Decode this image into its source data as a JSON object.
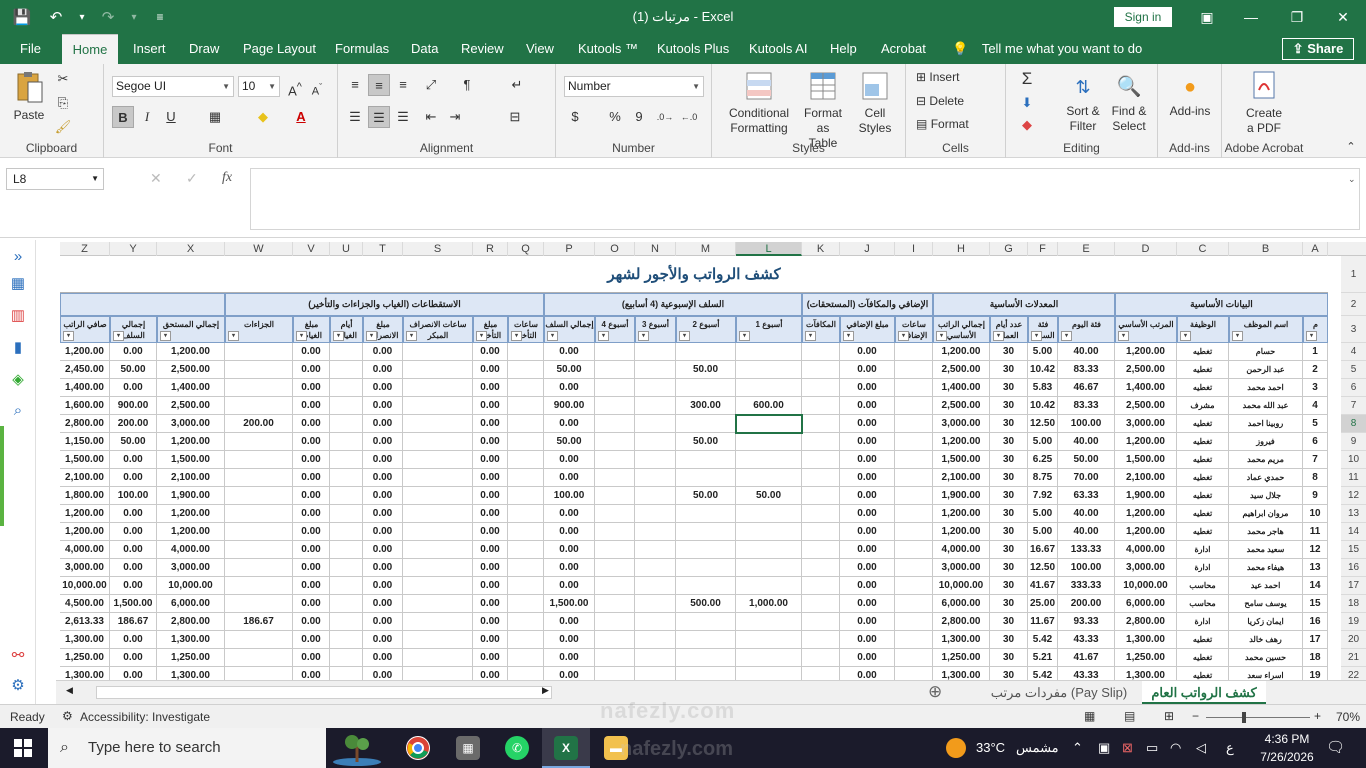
{
  "window": {
    "title": "مرتبات (1)  -  Excel",
    "sign_in": "Sign in",
    "minimize": "—",
    "restore": "❐",
    "close": "✕",
    "ribbon_display": "▣"
  },
  "qat": {
    "save": "💾",
    "undo": "↶",
    "undo_dd": "▾",
    "redo": "↷",
    "redo_dd": "▾",
    "customize": "≡"
  },
  "tabs": [
    "File",
    "Home",
    "Insert",
    "Draw",
    "Page Layout",
    "Formulas",
    "Data",
    "Review",
    "View",
    "Kutools ™",
    "Kutools Plus",
    "Kutools AI",
    "Help",
    "Acrobat"
  ],
  "tell_me": "Tell me what you want to do",
  "share": "Share",
  "ribbon": {
    "clipboard": {
      "label": "Clipboard",
      "paste": "Paste"
    },
    "font": {
      "label": "Font",
      "font_name": "Segoe UI",
      "font_size": "10",
      "bold": "B",
      "italic": "I",
      "underline": "U"
    },
    "alignment": {
      "label": "Alignment"
    },
    "number": {
      "label": "Number",
      "format": "Number",
      "currency": "$",
      "percent": "%",
      "comma": "9"
    },
    "styles": {
      "label": "Styles",
      "conditional_line1": "Conditional",
      "conditional_line2": "Formatting",
      "table_line1": "Format as",
      "table_line2": "Table",
      "cell_line1": "Cell",
      "cell_line2": "Styles"
    },
    "cells": {
      "label": "Cells",
      "insert": "Insert",
      "delete": "Delete",
      "format": "Format"
    },
    "editing": {
      "label": "Editing",
      "sort_line1": "Sort &",
      "sort_line2": "Filter",
      "find_line1": "Find &",
      "find_line2": "Select"
    },
    "addins": {
      "label": "Add-ins",
      "button": "Add-ins"
    },
    "acrobat": {
      "label": "Adobe Acrobat",
      "line1": "Create",
      "line2": "a PDF"
    }
  },
  "formula_bar": {
    "name_box": "L8",
    "fx": "fx",
    "cancel": "✕",
    "enter": "✓",
    "formula": ""
  },
  "columns": [
    "Z",
    "Y",
    "X",
    "W",
    "V",
    "U",
    "T",
    "S",
    "R",
    "Q",
    "P",
    "O",
    "N",
    "M",
    "L",
    "K",
    "J",
    "I",
    "H",
    "G",
    "F",
    "E",
    "D",
    "C",
    "B",
    "A"
  ],
  "selected_column": "L",
  "row_headers": [
    "1",
    "2",
    "3",
    "4",
    "5",
    "6",
    "7",
    "8",
    "9",
    "10",
    "11",
    "12",
    "13",
    "14",
    "15",
    "16",
    "17",
    "18",
    "19",
    "20",
    "21",
    "22"
  ],
  "selected_row": "8",
  "sheet": {
    "title": "كشف الرواتب والأجور لشهر",
    "bands": {
      "basic": "البيانات الأساسية",
      "rates": "المعدلات الأساسية",
      "bonuses": "الإضافي والمكافآت (المستحقات)",
      "advances": "السلف الإسبوعية (4 أسابيع)",
      "deductions": "الاستقطاعات (الغياب والجزاءات والتأخير)"
    },
    "headers": {
      "net": "صافي الراتب",
      "total_advances": "إجمالي السلف",
      "total_due": "إجمالي المستحق",
      "penalties": "الجزاءات",
      "absence_amount": "مبلغ الغياب",
      "absence_days": "أيام الغياب",
      "early_amount": "مبلغ الانصراف",
      "early_hours": "ساعات الانصراف المبكر",
      "late_amount": "مبلغ التأخير",
      "late_hours": "ساعات التأخير",
      "advances_total": "إجمالي السلف",
      "week4": "أسبوع 4",
      "week3": "أسبوع 3",
      "week2": "أسبوع 2",
      "week1": "أسبوع 1",
      "bonus": "المكافآت",
      "overtime_amount": "مبلغ الإضافي",
      "overtime_hours": "ساعات الإضافي",
      "gross": "إجمالي الراتب الأساسي",
      "work_days": "عدد أيام العمل",
      "hour_rate": "فئة الساعة",
      "day_rate": "فئة اليوم",
      "salary": "المرتب الأساسي",
      "job": "الوظيفة",
      "name": "اسم الموظف",
      "num": "م"
    },
    "rows": [
      {
        "n": "1",
        "name": "حسام",
        "job": "تغطيه",
        "salary": "1,200.00",
        "day": "40.00",
        "hour": "5.00",
        "days": "30",
        "gross": "1,200.00",
        "ot": "0.00",
        "w1": "",
        "w2": "",
        "adv": "0.00",
        "late": "0.00",
        "early": "0.00",
        "abs": "0.00",
        "pen": "",
        "due": "1,200.00",
        "tadv": "0.00",
        "net": "1,200.00"
      },
      {
        "n": "2",
        "name": "عبد الرحمن",
        "job": "تغطيه",
        "salary": "2,500.00",
        "day": "83.33",
        "hour": "10.42",
        "days": "30",
        "gross": "2,500.00",
        "ot": "0.00",
        "w1": "",
        "w2": "50.00",
        "adv": "50.00",
        "late": "0.00",
        "early": "0.00",
        "abs": "0.00",
        "pen": "",
        "due": "2,500.00",
        "tadv": "50.00",
        "net": "2,450.00"
      },
      {
        "n": "3",
        "name": "احمد محمد",
        "job": "تغطيه",
        "salary": "1,400.00",
        "day": "46.67",
        "hour": "5.83",
        "days": "30",
        "gross": "1,400.00",
        "ot": "0.00",
        "w1": "",
        "w2": "",
        "adv": "0.00",
        "late": "0.00",
        "early": "0.00",
        "abs": "0.00",
        "pen": "",
        "due": "1,400.00",
        "tadv": "0.00",
        "net": "1,400.00"
      },
      {
        "n": "4",
        "name": "عبد الله محمد",
        "job": "مشرف",
        "salary": "2,500.00",
        "day": "83.33",
        "hour": "10.42",
        "days": "30",
        "gross": "2,500.00",
        "ot": "0.00",
        "w1": "600.00",
        "w2": "300.00",
        "adv": "900.00",
        "late": "0.00",
        "early": "0.00",
        "abs": "0.00",
        "pen": "",
        "due": "2,500.00",
        "tadv": "900.00",
        "net": "1,600.00"
      },
      {
        "n": "5",
        "name": "روبينا احمد",
        "job": "تغطيه",
        "salary": "3,000.00",
        "day": "100.00",
        "hour": "12.50",
        "days": "30",
        "gross": "3,000.00",
        "ot": "0.00",
        "w1": "",
        "w2": "",
        "adv": "0.00",
        "late": "0.00",
        "early": "0.00",
        "abs": "0.00",
        "pen": "200.00",
        "due": "3,000.00",
        "tadv": "200.00",
        "net": "2,800.00"
      },
      {
        "n": "6",
        "name": "فيروز",
        "job": "تغطيه",
        "salary": "1,200.00",
        "day": "40.00",
        "hour": "5.00",
        "days": "30",
        "gross": "1,200.00",
        "ot": "0.00",
        "w1": "",
        "w2": "50.00",
        "adv": "50.00",
        "late": "0.00",
        "early": "0.00",
        "abs": "0.00",
        "pen": "",
        "due": "1,200.00",
        "tadv": "50.00",
        "net": "1,150.00"
      },
      {
        "n": "7",
        "name": "مريم محمد",
        "job": "تغطيه",
        "salary": "1,500.00",
        "day": "50.00",
        "hour": "6.25",
        "days": "30",
        "gross": "1,500.00",
        "ot": "0.00",
        "w1": "",
        "w2": "",
        "adv": "0.00",
        "late": "0.00",
        "early": "0.00",
        "abs": "0.00",
        "pen": "",
        "due": "1,500.00",
        "tadv": "0.00",
        "net": "1,500.00"
      },
      {
        "n": "8",
        "name": "حمدي عماد",
        "job": "تغطيه",
        "salary": "2,100.00",
        "day": "70.00",
        "hour": "8.75",
        "days": "30",
        "gross": "2,100.00",
        "ot": "0.00",
        "w1": "",
        "w2": "",
        "adv": "0.00",
        "late": "0.00",
        "early": "0.00",
        "abs": "0.00",
        "pen": "",
        "due": "2,100.00",
        "tadv": "0.00",
        "net": "2,100.00"
      },
      {
        "n": "9",
        "name": "جلال سيد",
        "job": "تغطيه",
        "salary": "1,900.00",
        "day": "63.33",
        "hour": "7.92",
        "days": "30",
        "gross": "1,900.00",
        "ot": "0.00",
        "w1": "50.00",
        "w2": "50.00",
        "adv": "100.00",
        "late": "0.00",
        "early": "0.00",
        "abs": "0.00",
        "pen": "",
        "due": "1,900.00",
        "tadv": "100.00",
        "net": "1,800.00"
      },
      {
        "n": "10",
        "name": "مروان ابراهيم",
        "job": "تغطيه",
        "salary": "1,200.00",
        "day": "40.00",
        "hour": "5.00",
        "days": "30",
        "gross": "1,200.00",
        "ot": "0.00",
        "w1": "",
        "w2": "",
        "adv": "0.00",
        "late": "0.00",
        "early": "0.00",
        "abs": "0.00",
        "pen": "",
        "due": "1,200.00",
        "tadv": "0.00",
        "net": "1,200.00"
      },
      {
        "n": "11",
        "name": "هاجر محمد",
        "job": "تغطيه",
        "salary": "1,200.00",
        "day": "40.00",
        "hour": "5.00",
        "days": "30",
        "gross": "1,200.00",
        "ot": "0.00",
        "w1": "",
        "w2": "",
        "adv": "0.00",
        "late": "0.00",
        "early": "0.00",
        "abs": "0.00",
        "pen": "",
        "due": "1,200.00",
        "tadv": "0.00",
        "net": "1,200.00"
      },
      {
        "n": "12",
        "name": "سعيد محمد",
        "job": "ادارة",
        "salary": "4,000.00",
        "day": "133.33",
        "hour": "16.67",
        "days": "30",
        "gross": "4,000.00",
        "ot": "0.00",
        "w1": "",
        "w2": "",
        "adv": "0.00",
        "late": "0.00",
        "early": "0.00",
        "abs": "0.00",
        "pen": "",
        "due": "4,000.00",
        "tadv": "0.00",
        "net": "4,000.00"
      },
      {
        "n": "13",
        "name": "هيفاء محمد",
        "job": "ادارة",
        "salary": "3,000.00",
        "day": "100.00",
        "hour": "12.50",
        "days": "30",
        "gross": "3,000.00",
        "ot": "0.00",
        "w1": "",
        "w2": "",
        "adv": "0.00",
        "late": "0.00",
        "early": "0.00",
        "abs": "0.00",
        "pen": "",
        "due": "3,000.00",
        "tadv": "0.00",
        "net": "3,000.00"
      },
      {
        "n": "14",
        "name": "احمد عيد",
        "job": "محاسب",
        "salary": "10,000.00",
        "day": "333.33",
        "hour": "41.67",
        "days": "30",
        "gross": "10,000.00",
        "ot": "0.00",
        "w1": "",
        "w2": "",
        "adv": "0.00",
        "late": "0.00",
        "early": "0.00",
        "abs": "0.00",
        "pen": "",
        "due": "10,000.00",
        "tadv": "0.00",
        "net": "10,000.00"
      },
      {
        "n": "15",
        "name": "يوسف سامح",
        "job": "محاسب",
        "salary": "6,000.00",
        "day": "200.00",
        "hour": "25.00",
        "days": "30",
        "gross": "6,000.00",
        "ot": "0.00",
        "w1": "1,000.00",
        "w2": "500.00",
        "adv": "1,500.00",
        "late": "0.00",
        "early": "0.00",
        "abs": "0.00",
        "pen": "",
        "due": "6,000.00",
        "tadv": "1,500.00",
        "net": "4,500.00"
      },
      {
        "n": "16",
        "name": "ايمان زكريا",
        "job": "ادارة",
        "salary": "2,800.00",
        "day": "93.33",
        "hour": "11.67",
        "days": "30",
        "gross": "2,800.00",
        "ot": "0.00",
        "w1": "",
        "w2": "",
        "adv": "0.00",
        "late": "0.00",
        "early": "0.00",
        "abs": "0.00",
        "pen": "186.67",
        "due": "2,800.00",
        "tadv": "186.67",
        "net": "2,613.33"
      },
      {
        "n": "17",
        "name": "رهف خالد",
        "job": "تغطيه",
        "salary": "1,300.00",
        "day": "43.33",
        "hour": "5.42",
        "days": "30",
        "gross": "1,300.00",
        "ot": "0.00",
        "w1": "",
        "w2": "",
        "adv": "0.00",
        "late": "0.00",
        "early": "0.00",
        "abs": "0.00",
        "pen": "",
        "due": "1,300.00",
        "tadv": "0.00",
        "net": "1,300.00"
      },
      {
        "n": "18",
        "name": "حسين محمد",
        "job": "تغطيه",
        "salary": "1,250.00",
        "day": "41.67",
        "hour": "5.21",
        "days": "30",
        "gross": "1,250.00",
        "ot": "0.00",
        "w1": "",
        "w2": "",
        "adv": "0.00",
        "late": "0.00",
        "early": "0.00",
        "abs": "0.00",
        "pen": "",
        "due": "1,250.00",
        "tadv": "0.00",
        "net": "1,250.00"
      },
      {
        "n": "19",
        "name": "اسراء سعد",
        "job": "تغطيه",
        "salary": "1,300.00",
        "day": "43.33",
        "hour": "5.42",
        "days": "30",
        "gross": "1,300.00",
        "ot": "0.00",
        "w1": "",
        "w2": "",
        "adv": "0.00",
        "late": "0.00",
        "early": "0.00",
        "abs": "0.00",
        "pen": "",
        "due": "1,300.00",
        "tadv": "0.00",
        "net": "1,300.00"
      }
    ]
  },
  "sheet_tabs": {
    "add": "⊕",
    "tab1": "مفردات مرتب (Pay Slip)",
    "tab2": "كشف الرواتب العام"
  },
  "status": {
    "ready": "Ready",
    "accessibility": "Accessibility: Investigate",
    "zoom": "70%",
    "minus": "−",
    "plus": "+"
  },
  "watermark": "nafezly.com",
  "taskbar": {
    "search_placeholder": "Type here to search",
    "weather_temp": "33°C",
    "weather_text": "مشمس",
    "lang": "ع",
    "time": "4:36 PM",
    "date": "7/26/2026"
  },
  "colors": {
    "excel_green": "#217346",
    "header_blue": "#dde7f5",
    "title_blue": "#1f4e79"
  }
}
